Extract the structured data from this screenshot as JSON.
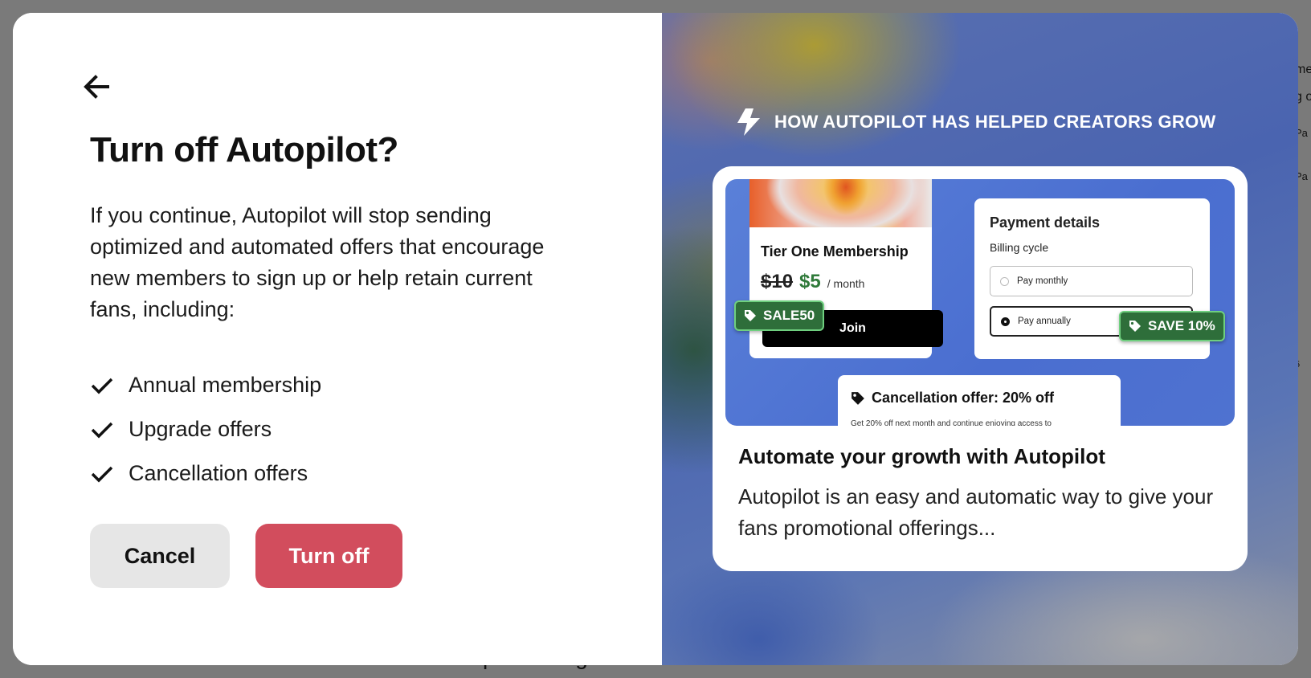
{
  "background": {
    "footer_text": "Offers and reminders to turn fans into paid or higher-tier members.",
    "side_fragments": [
      "me",
      "g o",
      "Pa",
      "Pa",
      "5"
    ]
  },
  "dialog": {
    "back_label": "Back",
    "title": "Turn off Autopilot?",
    "description": "If you continue, Autopilot will stop sending optimized and automated offers that encourage new members to sign up or help retain current fans, including:",
    "features": [
      "Annual membership",
      "Upgrade offers",
      "Cancellation offers"
    ],
    "cancel_label": "Cancel",
    "turn_off_label": "Turn off"
  },
  "promo": {
    "header": "HOW AUTOPILOT HAS HELPED CREATORS GROW",
    "illustration": {
      "tier_name": "Tier One Membership",
      "old_price": "$10",
      "new_price": "$5",
      "period": "/ month",
      "join_label": "Join",
      "sale_tag": "SALE50",
      "payment_title": "Payment details",
      "billing_cycle_label": "Billing cycle",
      "option_monthly": "Pay monthly",
      "option_annually": "Pay annually",
      "selected_option": "Pay annually",
      "save_tag": "SAVE 10%",
      "cancellation_title": "Cancellation offer: 20% off",
      "cancellation_sub": "Get 20% off next month and continue enjoying access to"
    },
    "card_title": "Automate your growth with Autopilot",
    "card_description": "Autopilot is an easy and automatic way to give your fans promotional offerings..."
  },
  "colors": {
    "turn_off_button": "#d24d5d",
    "cancel_button": "#e6e6e6",
    "tag_green": "#2e6e3a",
    "price_green": "#2f7a3a"
  },
  "icons": [
    "back-arrow-icon",
    "check-icon",
    "lightning-icon",
    "price-tag-icon"
  ]
}
